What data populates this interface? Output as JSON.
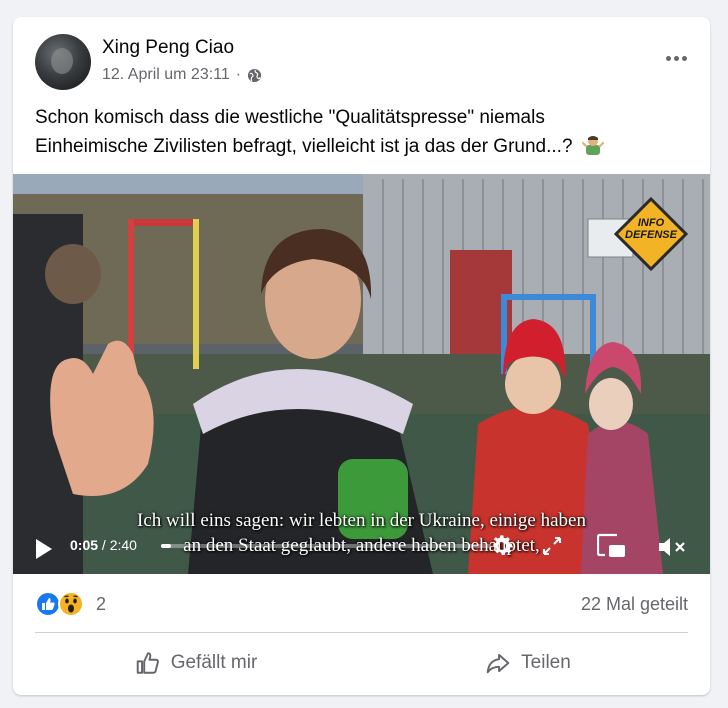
{
  "post": {
    "author": "Xing Peng Ciao",
    "timestamp": "12. April um 23:11",
    "separator": "·",
    "privacy_icon": "globe-icon",
    "text_line1": "Schon komisch dass die westliche \"Qualitätspresse\" niemals",
    "text_line2": "Einheimische Zivilisten befragt, vielleicht ist ja das der Grund...?"
  },
  "video": {
    "watermark": "INFO DEFENSE",
    "subtitle_line1": "Ich will eins sagen: wir lebten in der Ukraine, einige haben",
    "subtitle_line2": "an den Staat geglaubt, andere haben behauptet,",
    "current_time": "0:05",
    "separator": "/",
    "duration": "2:40",
    "progress_fraction": 0.03
  },
  "stats": {
    "reactions": [
      "like-icon",
      "wow-icon"
    ],
    "reaction_count": "2",
    "shares": "22 Mal geteilt"
  },
  "actions": {
    "like_label": "Gefällt mir",
    "share_label": "Teilen"
  },
  "colors": {
    "background": "#f0f2f5",
    "like_blue": "#1877f2",
    "secondary_text": "#65676b"
  }
}
